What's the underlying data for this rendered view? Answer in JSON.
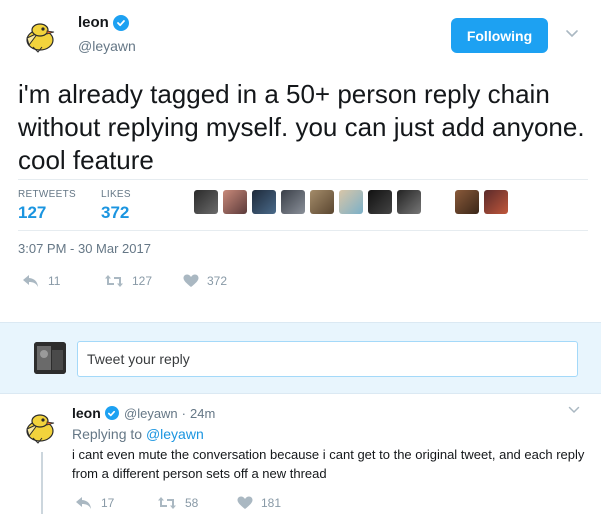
{
  "tweet": {
    "author_name": "leon",
    "author_handle": "@leyawn",
    "follow_label": "Following",
    "text": "i'm already tagged in a 50+ person reply chain without replying myself. you can just add anyone. cool feature",
    "retweets_label": "RETWEETS",
    "retweets_count": "127",
    "likes_label": "LIKES",
    "likes_count": "372",
    "timestamp": "3:07 PM - 30 Mar 2017",
    "actions": {
      "reply_count": "11",
      "retweet_count": "127",
      "like_count": "372"
    }
  },
  "reply_box": {
    "placeholder": "Tweet your reply"
  },
  "reply": {
    "author_name": "leon",
    "author_handle": "@leyawn",
    "separator": "·",
    "age": "24m",
    "replying_prefix": "Replying to",
    "replying_to": "@leyawn",
    "text": "i cant even mute the conversation because i cant get to the original tweet, and each reply from a different person sets off a new thread",
    "actions": {
      "reply_count": "17",
      "retweet_count": "58",
      "like_count": "181"
    }
  },
  "colors": {
    "accent": "#1da1f2",
    "link": "#1b95e0",
    "muted": "#657786",
    "reply_bg": "#e8f5fd"
  },
  "icons": [
    "bird-avatar-icon",
    "verified-badge-icon",
    "chevron-down-icon",
    "reply-icon",
    "retweet-icon",
    "heart-icon"
  ]
}
